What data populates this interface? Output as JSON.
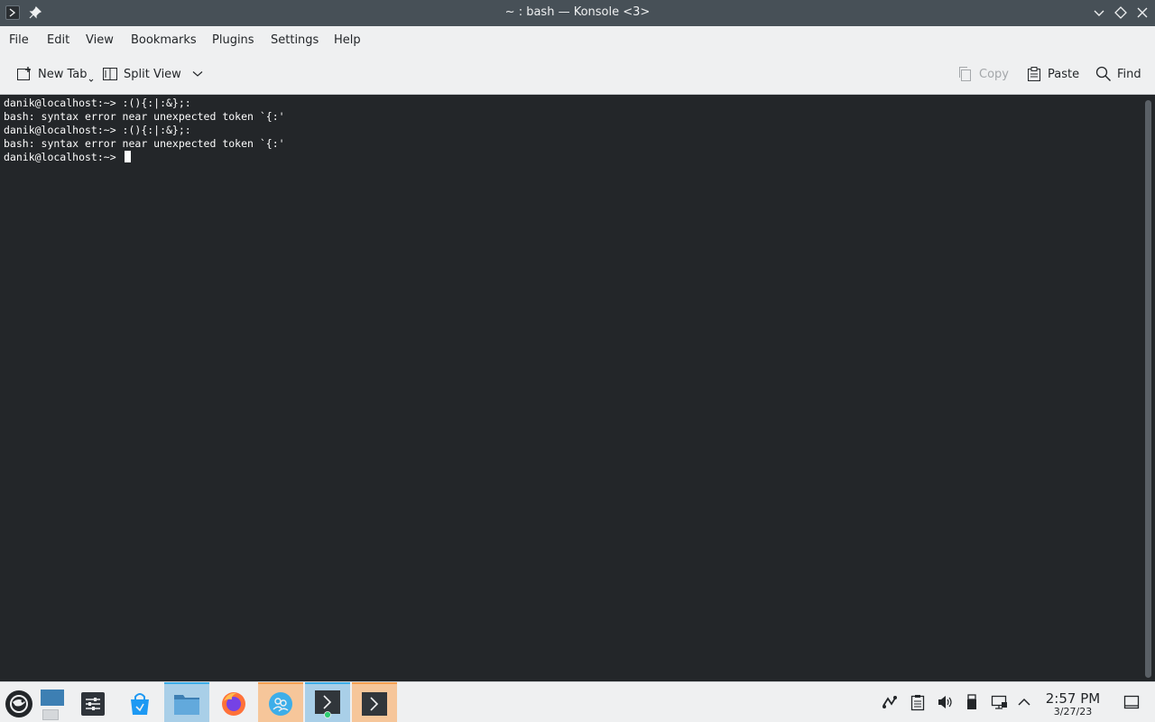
{
  "window": {
    "title": "~ : bash — Konsole <3>"
  },
  "menubar": {
    "items": [
      "File",
      "Edit",
      "View",
      "Bookmarks",
      "Plugins",
      "Settings",
      "Help"
    ]
  },
  "toolbar": {
    "new_tab": "New Tab",
    "split_view": "Split View",
    "copy": "Copy",
    "paste": "Paste",
    "find": "Find"
  },
  "terminal": {
    "lines": [
      "danik@localhost:~> :(){:|:&};:",
      "bash: syntax error near unexpected token `{:'",
      "danik@localhost:~> :(){:|:&};:",
      "bash: syntax error near unexpected token `{:'"
    ],
    "prompt": "danik@localhost:~> "
  },
  "taskbar": {
    "apps": [
      {
        "icon": "show-desktop-icon"
      },
      {
        "icon": "system-settings-icon"
      },
      {
        "icon": "discover-store-icon"
      },
      {
        "icon": "file-manager-icon"
      },
      {
        "icon": "firefox-icon"
      },
      {
        "icon": "contacts-icon"
      },
      {
        "icon": "konsole-icon"
      },
      {
        "icon": "konsole-icon"
      }
    ],
    "tray": [
      "kde-connect-icon",
      "clipboard-icon",
      "volume-icon",
      "usb-device-icon",
      "network-icon",
      "expand-tray-icon"
    ],
    "clock_time": "2:57 PM",
    "clock_date": "3/27/23"
  },
  "colors": {
    "titlebar": "#475057",
    "terminal_bg": "#232629",
    "terminal_fg": "#fcfcfc",
    "accent": "#3daee9",
    "attention": "#f6a050"
  }
}
